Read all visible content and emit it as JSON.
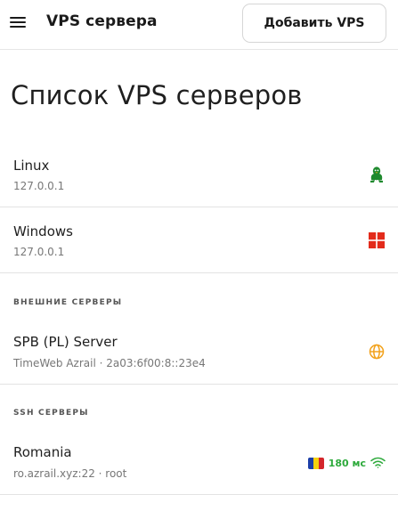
{
  "header": {
    "title": "VPS сервера",
    "add_button": "Добавить VPS"
  },
  "page": {
    "title": "Список VPS серверов"
  },
  "servers": [
    {
      "name": "Linux",
      "address": "127.0.0.1",
      "icon": "linux-penguin-icon",
      "icon_color": "#1f8a2e"
    },
    {
      "name": "Windows",
      "address": "127.0.0.1",
      "icon": "windows-icon",
      "icon_color": "#e32b1b"
    }
  ],
  "external": {
    "section_label": "ВНЕШНИЕ СЕРВЕРЫ",
    "items": [
      {
        "name": "SPB (PL) Server",
        "address": "TimeWeb Azrail · 2a03:6f00:8::23e4",
        "icon": "globe-icon",
        "icon_color": "#f2a21d"
      }
    ]
  },
  "ssh": {
    "section_label": "SSH СЕРВЕРЫ",
    "items": [
      {
        "name": "Romania",
        "address": "ro.azrail.xyz:22 · root",
        "flag": "romania-flag-icon",
        "ping": "180 мс",
        "ping_color": "#2eaa3c",
        "signal_icon": "wifi-icon"
      }
    ]
  }
}
